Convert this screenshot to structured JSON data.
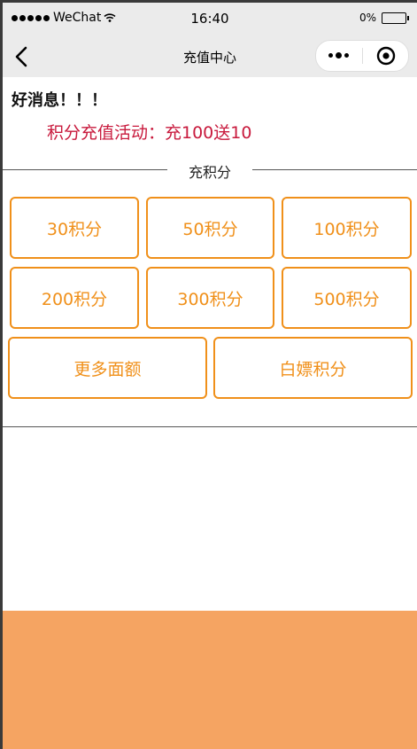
{
  "status_bar": {
    "carrier": "WeChat",
    "time": "16:40",
    "battery": "0%"
  },
  "nav": {
    "title": "充值中心"
  },
  "content": {
    "news_title": "好消息！！！",
    "promo_text": "积分充值活动：充100送10",
    "section_title": "充积分",
    "options_row1": [
      "30积分",
      "50积分",
      "100积分"
    ],
    "options_row2": [
      "200积分",
      "300积分",
      "500积分"
    ],
    "more_button": "更多面额",
    "free_button": "白嫖积分"
  },
  "colors": {
    "accent": "#f0901a",
    "promo": "#c8193c",
    "footer": "#f5a462"
  }
}
